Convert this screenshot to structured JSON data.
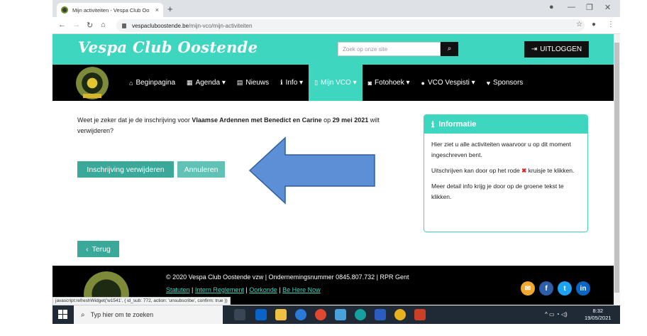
{
  "browser": {
    "tab_title": "Mijn activiteiten - Vespa Club Oo",
    "tab_close": "×",
    "new_tab": "+",
    "url_host": "vespaclubo­ostende.be",
    "url_host_plain": "vespacluboostende.be",
    "url_path": "/mijn-vco/mijn-activiteiten",
    "status_url": "javascript:refreshWidget('w1541', { id_sub: 772, action: 'unsubscribe', confirm: true })"
  },
  "header": {
    "brand": "Vespa Club Oostende",
    "search_placeholder": "Zoek op onze site",
    "logout_label": "UITLOGGEN"
  },
  "nav": {
    "items": [
      {
        "icon": "home-icon",
        "glyph": "⌂",
        "label": "Beginpagina"
      },
      {
        "icon": "calendar-icon",
        "glyph": "▦",
        "label": "Agenda ▾"
      },
      {
        "icon": "newspaper-icon",
        "glyph": "▤",
        "label": "Nieuws"
      },
      {
        "icon": "info-icon",
        "glyph": "ℹ",
        "label": "Info ▾"
      },
      {
        "icon": "document-icon",
        "glyph": "▯",
        "label": "Mijn VCO ▾"
      },
      {
        "icon": "camera-icon",
        "glyph": "◙",
        "label": "Fotohoek ▾"
      },
      {
        "icon": "pin-icon",
        "glyph": "●",
        "label": "VCO Vespisti ▾"
      },
      {
        "icon": "heart-icon",
        "glyph": "♥",
        "label": "Sponsors"
      }
    ]
  },
  "main": {
    "confirm_pre": "Weet je zeker dat je de inschrijving voor ",
    "confirm_event": "Vlaamse Ardennen met Benedict en Carine",
    "confirm_mid": " op ",
    "confirm_date": "29 mei 2021",
    "confirm_post": " wilt verwijderen?",
    "remove_button": "Inschrijving verwijderen",
    "cancel_button": "Annuleren",
    "back_button": "Terug"
  },
  "info": {
    "title": "Informatie",
    "p1": "Hier ziet u alle activiteiten waarvoor u op dit moment ingeschreven bent.",
    "p2_pre": "Uitschrijven kan door op het rode ",
    "p2_x": "✖",
    "p2_post": " kruisje te klikken.",
    "p3": "Meer detail info krijg je door op de groene tekst te klikken."
  },
  "footer": {
    "copyright": "© 2020 Vespa Club Oostende vzw | Ondernemingsnummer 0845.807.732 | RPR Gent",
    "links": [
      "Statuten",
      "Intern Reglement",
      "Oorkonde",
      "Be Here Now"
    ],
    "social": [
      {
        "icon": "email-icon",
        "glyph": "✉",
        "color": "#f0a830"
      },
      {
        "icon": "facebook-icon",
        "glyph": "f",
        "color": "#2f5ea8"
      },
      {
        "icon": "twitter-icon",
        "glyph": "t",
        "color": "#1da1f2"
      },
      {
        "icon": "linkedin-icon",
        "glyph": "in",
        "color": "#0a66c2"
      }
    ]
  },
  "taskbar": {
    "search_text": "Typ hier om te zoeken",
    "time": "8:32",
    "date": "19/05/2021"
  },
  "colors": {
    "accent": "#3fd6c0",
    "button": "#3ba99a",
    "nav_bg": "#000000",
    "arrow": "#5b8fd6"
  }
}
